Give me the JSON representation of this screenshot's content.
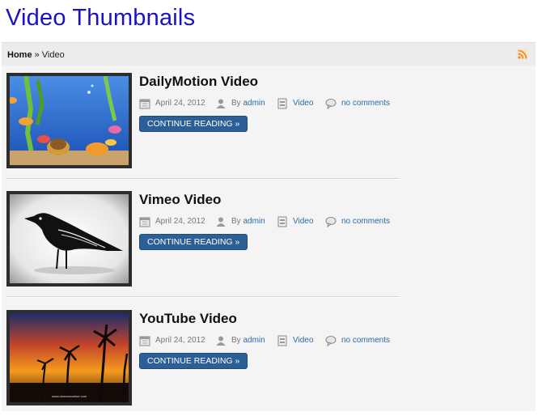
{
  "site": {
    "title": "Video Thumbnails"
  },
  "breadcrumb": {
    "home": "Home",
    "separator": " » ",
    "current": "Video"
  },
  "colors": {
    "title": "#1a12c2",
    "link": "#2c6aa8",
    "button_bg": "#2b5f95",
    "rss": "#f08a24"
  },
  "icons": {
    "rss": "rss-icon",
    "date": "calendar-icon",
    "author": "user-icon",
    "category": "category-icon",
    "comments": "comment-icon"
  },
  "posts": [
    {
      "title": "DailyMotion Video",
      "date": "April 24, 2012",
      "by": "By",
      "author": "admin",
      "category": "Video",
      "comments": "no comments",
      "button": "CONTINUE READING »",
      "thumbnail": "aquarium"
    },
    {
      "title": "Vimeo Video",
      "date": "April 24, 2012",
      "by": "By",
      "author": "admin",
      "category": "Video",
      "comments": "no comments",
      "button": "CONTINUE READING »",
      "thumbnail": "bird"
    },
    {
      "title": "YouTube Video",
      "date": "April 24, 2012",
      "by": "By",
      "author": "admin",
      "category": "Video",
      "comments": "no comments",
      "button": "CONTINUE READING »",
      "thumbnail": "sunset",
      "thumbnail_caption": "www.domaxsunrise.com"
    }
  ]
}
